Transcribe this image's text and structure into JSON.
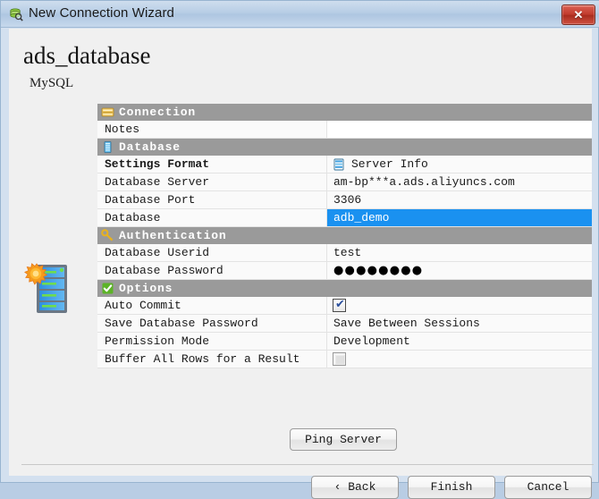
{
  "window": {
    "title": "New Connection Wizard",
    "title_icon": "database-search-icon",
    "close_label": "✕"
  },
  "page": {
    "title": "ads_database",
    "subtitle": "MySQL",
    "wizard_icon": "server-new-icon"
  },
  "grid": {
    "sections": [
      {
        "name": "Connection",
        "icon": "connection-icon",
        "rows": [
          {
            "label": "Notes",
            "value": "",
            "kind": "text",
            "field": "white"
          }
        ]
      },
      {
        "name": "Database",
        "icon": "database-icon",
        "rows": [
          {
            "label": "Settings Format",
            "value": "Server Info",
            "kind": "icon-text",
            "icon": "server-info-icon",
            "bold": true
          },
          {
            "label": "Database Server",
            "value": "am-bp***a.ads.aliyuncs.com",
            "kind": "text"
          },
          {
            "label": "Database Port",
            "value": "3306",
            "kind": "text"
          },
          {
            "label": "Database",
            "value": "adb_demo",
            "kind": "text",
            "selected": true
          }
        ]
      },
      {
        "name": "Authentication",
        "icon": "key-icon",
        "rows": [
          {
            "label": "Database Userid",
            "value": "test",
            "kind": "text"
          },
          {
            "label": "Database Password",
            "value": "●●●●●●●●",
            "kind": "password"
          }
        ]
      },
      {
        "name": "Options",
        "icon": "check-icon",
        "rows": [
          {
            "label": "Auto Commit",
            "value": "",
            "kind": "checkbox",
            "checked": true
          },
          {
            "label": "Save Database Password",
            "value": "Save Between Sessions",
            "kind": "text"
          },
          {
            "label": "Permission Mode",
            "value": "Development",
            "kind": "text"
          },
          {
            "label": "Buffer All Rows for a Result",
            "value": "",
            "kind": "checkbox",
            "checked": false
          }
        ]
      }
    ]
  },
  "actions": {
    "ping": "Ping Server",
    "back": "‹ Back",
    "finish": "Finish",
    "cancel": "Cancel"
  },
  "colors": {
    "section_bg": "#9a9a9a",
    "selection": "#1a91f0",
    "titlebar": "#b7cde5",
    "close": "#c0392b"
  }
}
